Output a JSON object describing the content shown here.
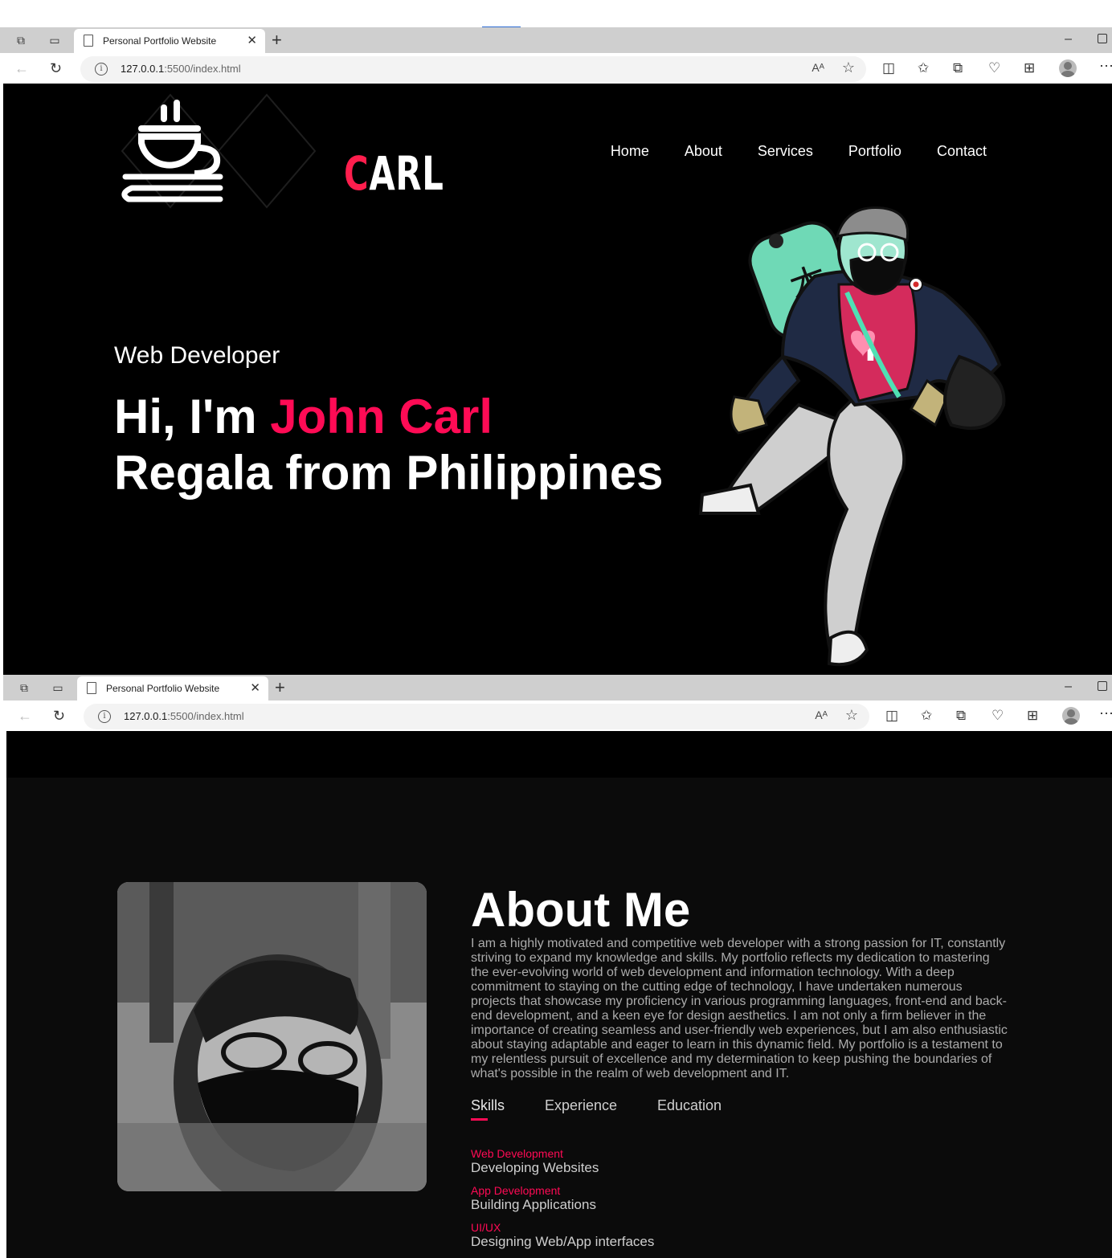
{
  "browser": {
    "tab_title": "Personal Portfolio Website",
    "url_host": "127.0.0.1",
    "url_rest": ":5500/index.html",
    "read_aloud": "Aᴬ"
  },
  "hero": {
    "logo_text_first": "C",
    "logo_text_rest": "ARL",
    "nav": [
      "Home",
      "About",
      "Services",
      "Portfolio",
      "Contact"
    ],
    "subtitle": "Web Developer",
    "greeting": "Hi, I'm ",
    "name": "John Carl",
    "line2": "Regala from Philippines"
  },
  "about": {
    "title": "About Me",
    "paragraph": "I am a highly motivated and competitive web developer with a strong passion for IT, constantly striving to expand my knowledge and skills. My portfolio reflects my dedication to mastering the ever-evolving world of web development and information technology. With a deep commitment to staying on the cutting edge of technology, I have undertaken numerous projects that showcase my proficiency in various programming languages, front-end and back-end development, and a keen eye for design aesthetics. I am not only a firm believer in the importance of creating seamless and user-friendly web experiences, but I am also enthusiastic about staying adaptable and eager to learn in this dynamic field. My portfolio is a testament to my relentless pursuit of excellence and my determination to keep pushing the boundaries of what's possible in the realm of web development and IT.",
    "tabs": [
      "Skills",
      "Experience",
      "Education"
    ],
    "skills": [
      {
        "title": "Web Development",
        "desc": "Developing Websites"
      },
      {
        "title": "App Development",
        "desc": "Building Applications"
      },
      {
        "title": "UI/UX",
        "desc": "Designing Web/App interfaces"
      }
    ]
  },
  "colors": {
    "accent": "#ff0b55",
    "hero_bg": "#000000",
    "about_bg": "#0b0b0b"
  }
}
